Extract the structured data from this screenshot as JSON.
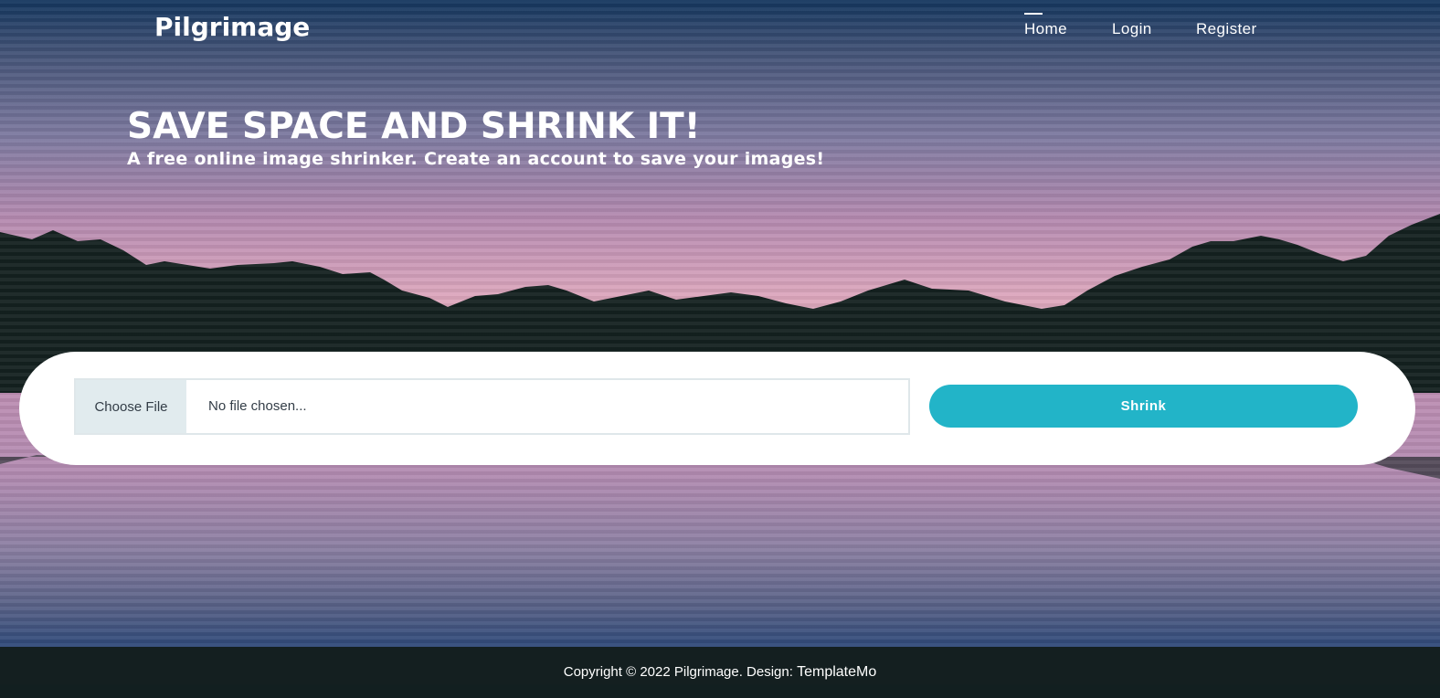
{
  "brand": {
    "name": "Pilgrimage"
  },
  "nav": {
    "items": [
      {
        "label": "Home",
        "active": true
      },
      {
        "label": "Login"
      },
      {
        "label": "Register"
      }
    ]
  },
  "hero": {
    "title": "SAVE SPACE AND SHRINK IT!",
    "subtitle": "A free online image shrinker. Create an account to save your images!"
  },
  "upload_form": {
    "choose_file_label": "Choose File",
    "file_status": "No file chosen...",
    "submit_label": "Shrink"
  },
  "footer": {
    "text": "Copyright © 2022 Pilgrimage. Design: ",
    "link_label": "TemplateMo"
  },
  "colors": {
    "accent": "#22b4c8",
    "mountains": "#142120",
    "footer_bg": "#141f20"
  }
}
